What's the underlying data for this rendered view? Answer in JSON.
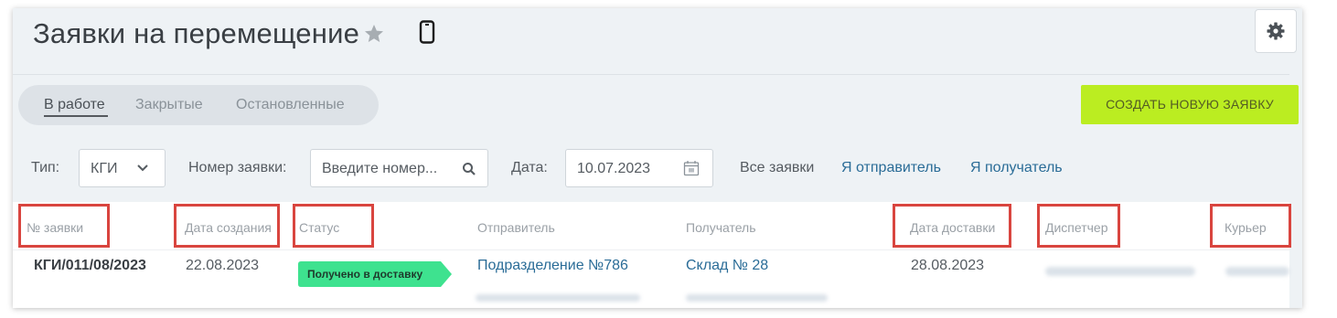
{
  "header": {
    "title": "Заявки на перемещение"
  },
  "tabs": [
    {
      "label": "В работе",
      "active": true
    },
    {
      "label": "Закрытые",
      "active": false
    },
    {
      "label": "Остановленные",
      "active": false
    }
  ],
  "actions": {
    "create_label": "СОЗДАТЬ НОВУЮ ЗАЯВКУ"
  },
  "filters": {
    "type_label": "Тип:",
    "type_value": "КГИ",
    "number_label": "Номер заявки:",
    "number_placeholder": "Введите номер...",
    "date_label": "Дата:",
    "date_value": "10.07.2023",
    "links": [
      "Все заявки",
      "Я отправитель",
      "Я получатель"
    ]
  },
  "table": {
    "columns": [
      "№ заявки",
      "Дата создания",
      "Статус",
      "Отправитель",
      "Получатель",
      "Дата доставки",
      "Диспетчер",
      "Курьер"
    ],
    "rows": [
      {
        "number": "КГИ/011/08/2023",
        "created": "22.08.2023",
        "status": "Получено в доставку",
        "sender": "Подразделение №786",
        "receiver": "Склад № 28",
        "delivery_date": "28.08.2023"
      }
    ]
  },
  "colors": {
    "accent": "#bbed21",
    "status_badge": "#3ee28f",
    "link": "#2a6c97",
    "highlight": "#d9453f"
  }
}
